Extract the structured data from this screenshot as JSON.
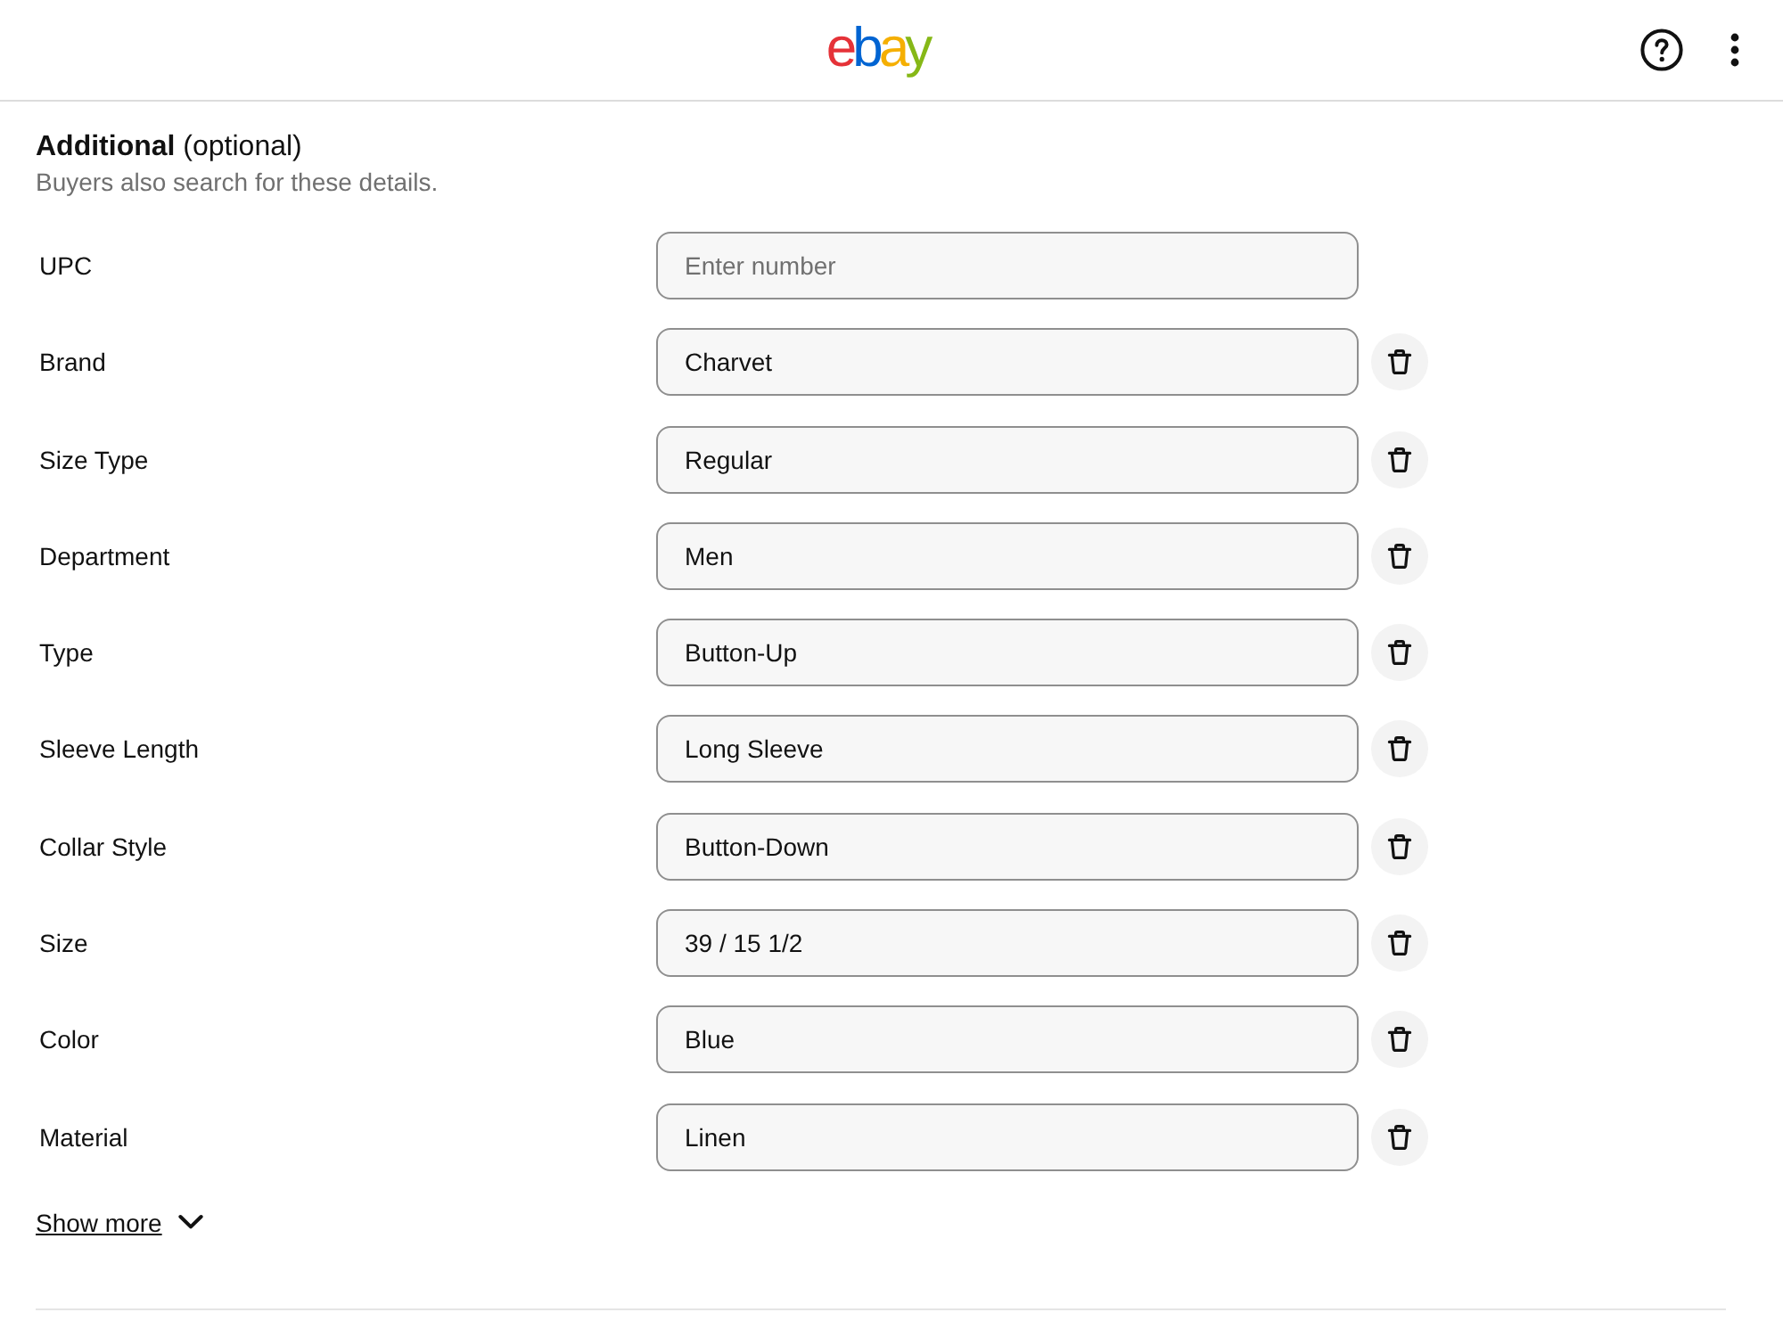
{
  "header": {
    "logo": "ebay"
  },
  "section": {
    "heading": "**Additional** (optional)",
    "subtitle": "Buyers also search for these details."
  },
  "fields": [
    {
      "label": "UPC",
      "placeholder": "Enter number",
      "removable": false
    },
    {
      "label": "Brand",
      "value": "Charvet",
      "removable": true
    },
    {
      "label": "Size Type",
      "value": "Regular",
      "removable": true
    },
    {
      "label": "Department",
      "value": "Men",
      "removable": true
    },
    {
      "label": "Type",
      "value": "Button-Up",
      "removable": true
    },
    {
      "label": "Sleeve Length",
      "value": "Long Sleeve",
      "removable": true
    },
    {
      "label": "Collar Style",
      "value": "Button-Down",
      "removable": true
    },
    {
      "label": "Size",
      "value": "39 / 15 1/2",
      "removable": true
    },
    {
      "label": "Color",
      "value": "Blue",
      "removable": true
    },
    {
      "label": "Material",
      "value": "Linen",
      "removable": true
    }
  ],
  "show_more": {
    "label": "Show more",
    "expanded": false
  }
}
